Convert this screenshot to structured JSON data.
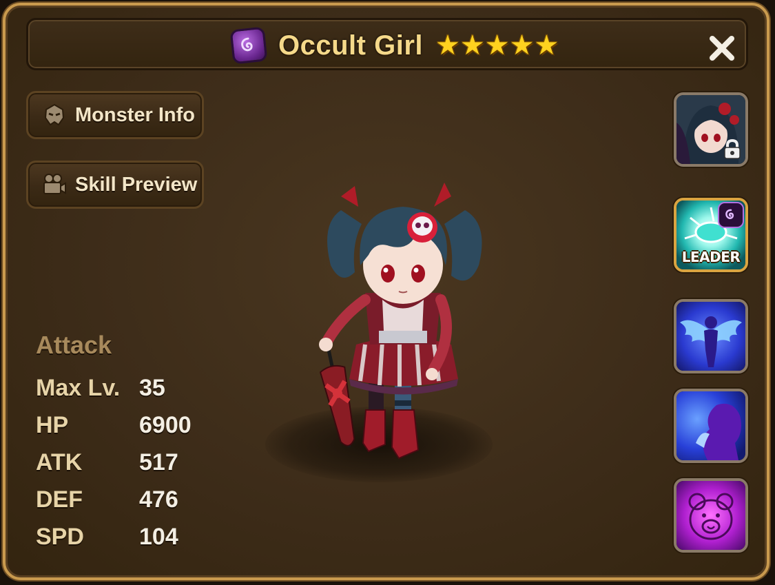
{
  "header": {
    "monster_name": "Occult Girl",
    "stars": [
      "★",
      "★",
      "★",
      "★",
      "★"
    ],
    "star_count": 5,
    "attribute_icon": "dark-attribute-icon",
    "close_icon": "close-icon"
  },
  "buttons": {
    "monster_info": "Monster Info",
    "skill_preview": "Skill Preview"
  },
  "stats": {
    "archetype": "Attack",
    "rows": [
      {
        "label": "Max Lv.",
        "value": "35"
      },
      {
        "label": "HP",
        "value": "6900"
      },
      {
        "label": "ATK",
        "value": "517"
      },
      {
        "label": "DEF",
        "value": "476"
      },
      {
        "label": "SPD",
        "value": "104"
      }
    ]
  },
  "side_icons": {
    "awakened_portrait": {
      "icon": "awakened-portrait-icon",
      "locked": true
    },
    "leader_skill": {
      "label": "LEADER",
      "icon": "leader-skill-icon"
    },
    "skills": [
      {
        "icon": "skill-angel-wings-icon"
      },
      {
        "icon": "skill-prayer-icon"
      },
      {
        "icon": "skill-teddy-bear-icon"
      }
    ]
  },
  "colors": {
    "frame_border": "#c99a4e",
    "title_text": "#f5d98a",
    "star": "#ffd21f",
    "archetype_text": "#a88a5c",
    "stat_label": "#e7d4a8"
  }
}
